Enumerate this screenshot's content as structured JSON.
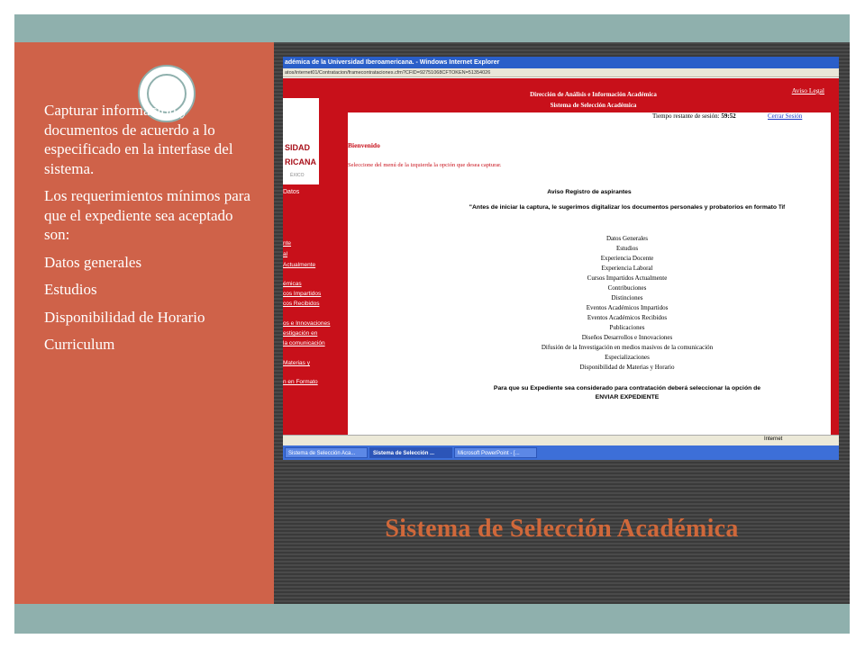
{
  "slide": {
    "title": "Sistema de Selección Académica",
    "bullets": [
      "Capturar informacion y documentos de acuerdo a lo especificado en la interfase del sistema.",
      "Los requerimientos mínimos para que el expediente sea aceptado son:",
      "Datos generales",
      "Estudios",
      "Disponibilidad de Horario",
      "Curriculum"
    ]
  },
  "browser": {
    "window_title": "adémica de la Universidad Iberoamericana. - Windows Internet Explorer",
    "address": "atos/internet01/Contratacion/framecontrataciones.cfm?CFID=92751068CFTOKEN=51354026",
    "status_zone": "Internet"
  },
  "site": {
    "logo_line1": "SIDAD",
    "logo_line2": "RICANA",
    "logo_line3": "ÉXICO",
    "header_line1": "Dirección de Análisis e Información Académica",
    "header_line2": "Sistema de Selección Académica",
    "aviso_legal": "Aviso Legal",
    "session_label": "Tiempo restante de sesión:",
    "session_time": "59:52",
    "logout": "Cerrar Sesión",
    "welcome": "Bienvenido",
    "instruction": "Seleccione del menú de la izquierda la opción que desea capturar.",
    "notice_title": "Aviso Registro de aspirantes",
    "notice_text": "\"Antes de iniciar la captura, le sugerimos digitalizar los documentos personales y probatorios en formato",
    "notice_format": "Tif",
    "sections": [
      "Datos Generales",
      "Estudios",
      "Experiencia Docente",
      "Experiencia Laboral",
      "Cursos Impartidos Actualmente",
      "Contribuciones",
      "Distinciones",
      "Eventos Académicos Impartidos",
      "Eventos Académicos Recibidos",
      "Publicaciones",
      "Diseños Desarrollos e Innovaciones",
      "Difusión de la Investigación en medios masivos de la comunicación",
      "Especializaciones",
      "Disponibilidad de Materias y Horario"
    ],
    "closing_line1": "Para que su Expediente sea considerado para contratación deberá seleccionar la opción de",
    "closing_line2": "ENVIAR EXPEDIENTE",
    "nav_links": [
      "Datos",
      "nte",
      "al",
      "Actualmente",
      "émicas",
      "cos Impartidos",
      "cos Recibidos",
      "os e Innovaciones",
      "estigación en",
      "la comunicación",
      "Materias y",
      "n en Formato"
    ],
    "nav_button": "na"
  },
  "taskbar": {
    "items": [
      "Sistema de Selección Aca...",
      "Sistema de Selección ...",
      "Microsoft PowerPoint - [..."
    ]
  }
}
